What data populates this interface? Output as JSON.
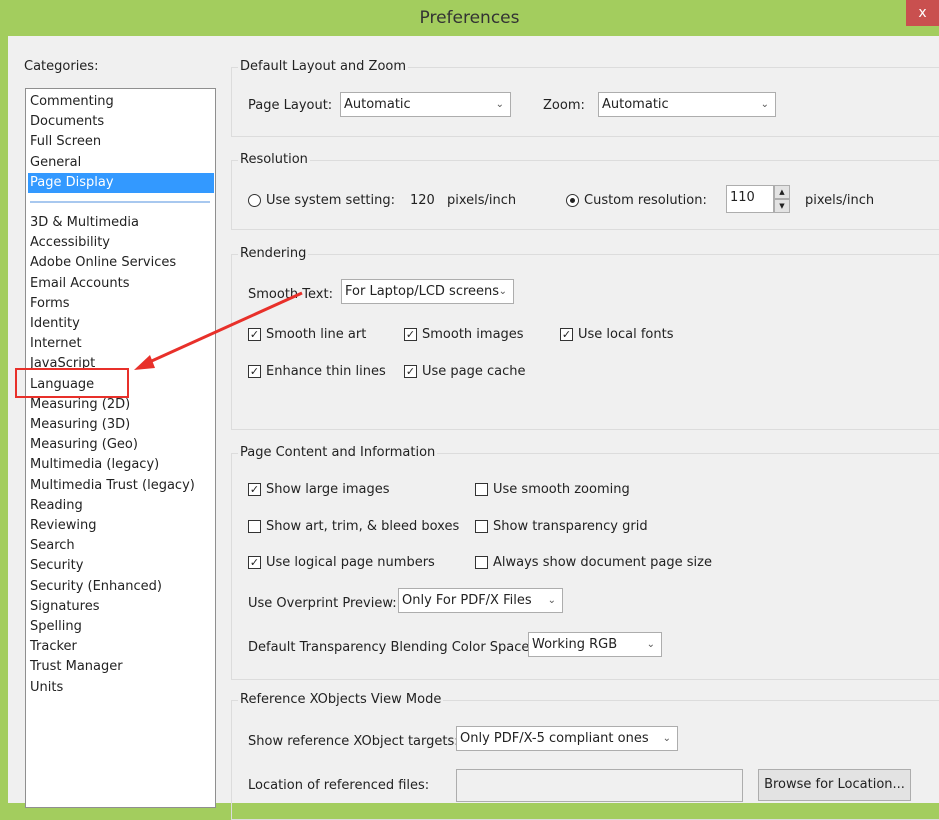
{
  "window": {
    "title": "Preferences",
    "close_label": "x"
  },
  "categories": {
    "label": "Categories:",
    "top": [
      "Commenting",
      "Documents",
      "Full Screen",
      "General",
      "Page Display"
    ],
    "selected": "Page Display",
    "rest": [
      "3D & Multimedia",
      "Accessibility",
      "Adobe Online Services",
      "Email Accounts",
      "Forms",
      "Identity",
      "Internet",
      "JavaScript",
      "Language",
      "Measuring (2D)",
      "Measuring (3D)",
      "Measuring (Geo)",
      "Multimedia (legacy)",
      "Multimedia Trust (legacy)",
      "Reading",
      "Reviewing",
      "Search",
      "Security",
      "Security (Enhanced)",
      "Signatures",
      "Spelling",
      "Tracker",
      "Trust Manager",
      "Units"
    ]
  },
  "annotation": {
    "highlighted": "Language",
    "color": "#e8302a"
  },
  "layout_zoom": {
    "title": "Default Layout and Zoom",
    "page_layout_label": "Page Layout:",
    "page_layout": "Automatic",
    "zoom_label": "Zoom:",
    "zoom": "Automatic"
  },
  "resolution": {
    "title": "Resolution",
    "system_label": "Use system setting:",
    "system_value": "120",
    "system_unit": "pixels/inch",
    "custom_label": "Custom resolution:",
    "custom_value": "110",
    "custom_unit": "pixels/inch",
    "selected": "custom"
  },
  "rendering": {
    "title": "Rendering",
    "smooth_text_label": "Smooth Text:",
    "smooth_text": "For Laptop/LCD screens",
    "checks": [
      {
        "label": "Smooth line art",
        "checked": true
      },
      {
        "label": "Smooth images",
        "checked": true
      },
      {
        "label": "Use local fonts",
        "checked": true
      },
      {
        "label": "Enhance thin lines",
        "checked": true
      },
      {
        "label": "Use page cache",
        "checked": true
      }
    ]
  },
  "page_content": {
    "title": "Page Content and Information",
    "checks": [
      {
        "label": "Show large images",
        "checked": true
      },
      {
        "label": "Use smooth zooming",
        "checked": false
      },
      {
        "label": "Show art, trim, & bleed boxes",
        "checked": false
      },
      {
        "label": "Show transparency grid",
        "checked": false
      },
      {
        "label": "Use logical page numbers",
        "checked": true
      },
      {
        "label": "Always show document page size",
        "checked": false
      }
    ],
    "overprint_label": "Use Overprint Preview:",
    "overprint": "Only For PDF/X Files",
    "blend_label": "Default Transparency Blending Color Space:",
    "blend": "Working RGB"
  },
  "xobjects": {
    "title": "Reference XObjects View Mode",
    "targets_label": "Show reference XObject targets:",
    "targets": "Only PDF/X-5 compliant ones",
    "location_label": "Location of referenced files:",
    "location_value": "",
    "browse_label": "Browse for Location..."
  }
}
